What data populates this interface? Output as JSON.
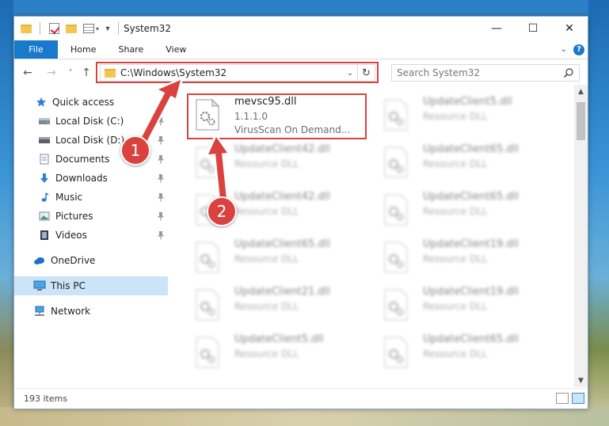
{
  "window": {
    "title": "System32",
    "minimize": "—",
    "maximize": "☐",
    "close": "✕"
  },
  "ribbon": {
    "tabs": [
      "File",
      "Home",
      "Share",
      "View"
    ],
    "help": "?"
  },
  "nav": {
    "back": "←",
    "forward": "→",
    "recent": "˅",
    "up": "↑"
  },
  "address": {
    "path": "C:\\Windows\\System32",
    "dropdown": "⌄",
    "refresh": "↻"
  },
  "search": {
    "placeholder": "Search System32"
  },
  "sidebar": {
    "items": [
      {
        "label": "Quick access",
        "icon": "star-icon",
        "pinned": false
      },
      {
        "label": "Local Disk (C:)",
        "icon": "drive-icon",
        "pinned": true
      },
      {
        "label": "Local Disk (D:)",
        "icon": "drive-icon",
        "pinned": true
      },
      {
        "label": "Documents",
        "icon": "documents-icon",
        "pinned": true
      },
      {
        "label": "Downloads",
        "icon": "downloads-icon",
        "pinned": true
      },
      {
        "label": "Music",
        "icon": "music-icon",
        "pinned": true
      },
      {
        "label": "Pictures",
        "icon": "pictures-icon",
        "pinned": true
      },
      {
        "label": "Videos",
        "icon": "videos-icon",
        "pinned": true
      },
      {
        "label": "OneDrive",
        "icon": "cloud-icon",
        "pinned": false
      },
      {
        "label": "This PC",
        "icon": "computer-icon",
        "pinned": false,
        "selected": true
      },
      {
        "label": "Network",
        "icon": "network-icon",
        "pinned": false
      }
    ]
  },
  "files": {
    "highlighted": {
      "name": "mevsc95.dll",
      "version": "1.1.1.0",
      "description": "VirusScan On Demand..."
    },
    "column_left": [
      {
        "name": "UpdateClient42.dll",
        "type": "Resource DLL"
      },
      {
        "name": "UpdateClient42.dll",
        "type": "Resource DLL"
      },
      {
        "name": "UpdateClient65.dll",
        "type": "Resource DLL"
      },
      {
        "name": "UpdateClient21.dll",
        "type": "Resource DLL"
      },
      {
        "name": "UpdateClient5.dll",
        "type": "Resource DLL"
      }
    ],
    "column_right": [
      {
        "name": "UpdateClient5.dll",
        "type": "Resource DLL"
      },
      {
        "name": "UpdateClient65.dll",
        "type": "Resource DLL"
      },
      {
        "name": "UpdateClient65.dll",
        "type": "Resource DLL"
      },
      {
        "name": "UpdateClient19.dll",
        "type": "Resource DLL"
      },
      {
        "name": "UpdateClient19.dll",
        "type": "Resource DLL"
      },
      {
        "name": "UpdateClient65.dll",
        "type": "Resource DLL"
      }
    ]
  },
  "status": {
    "item_count": "193 items"
  },
  "callouts": [
    "1",
    "2"
  ],
  "colors": {
    "accent": "#1979ca",
    "highlight": "#d9423f",
    "selected": "#cce4f7"
  }
}
